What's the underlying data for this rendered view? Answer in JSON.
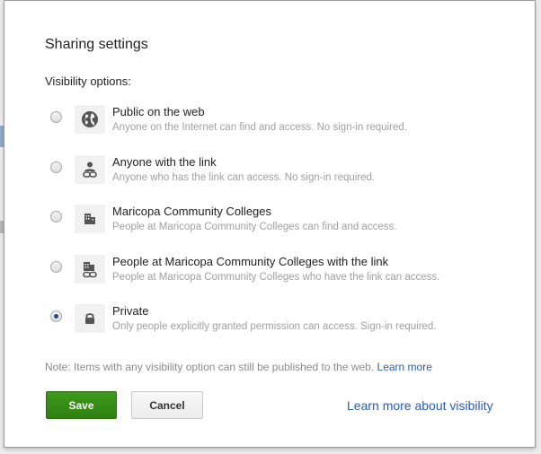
{
  "dialog": {
    "title": "Sharing settings",
    "section_label": "Visibility options:",
    "options": [
      {
        "title": "Public on the web",
        "description": "Anyone on the Internet can find and access. No sign-in required.",
        "icon": "globe-icon",
        "selected": false
      },
      {
        "title": "Anyone with the link",
        "description": "Anyone who has the link can access. No sign-in required.",
        "icon": "person-link-icon",
        "selected": false
      },
      {
        "title": "Maricopa Community Colleges",
        "description": "People at Maricopa Community Colleges can find and access.",
        "icon": "building-icon",
        "selected": false
      },
      {
        "title": "People at Maricopa Community Colleges with the link",
        "description": "People at Maricopa Community Colleges who have the link can access.",
        "icon": "building-link-icon",
        "selected": false
      },
      {
        "title": "Private",
        "description": "Only people explicitly granted permission can access. Sign-in required.",
        "icon": "lock-icon",
        "selected": true
      }
    ],
    "note_text": "Note: Items with any visibility option can still be published to the web.",
    "note_link": "Learn more",
    "save_label": "Save",
    "cancel_label": "Cancel",
    "visibility_link": "Learn more about visibility"
  },
  "colors": {
    "save_green": "#359015",
    "link_blue": "#2a5db0",
    "radio_selected": "#2b4a7a"
  }
}
